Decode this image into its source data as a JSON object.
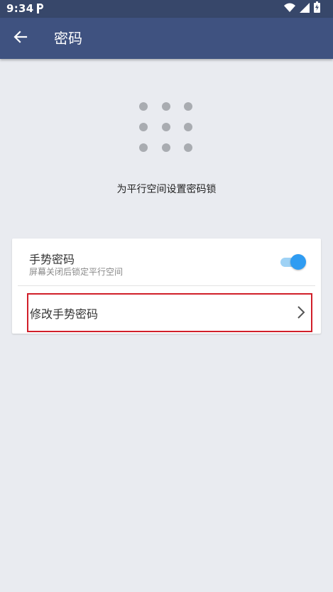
{
  "status_bar": {
    "time": "9:34",
    "icons": [
      "parking-icon",
      "wifi-icon",
      "signal-icon",
      "battery-charging-icon"
    ]
  },
  "app_bar": {
    "back_icon": "arrow-left-icon",
    "title": "密码"
  },
  "pattern": {
    "icon": "pattern-dots-icon",
    "caption": "为平行空间设置密码锁"
  },
  "settings": {
    "gesture_password": {
      "title": "手势密码",
      "subtitle": "屏幕关闭后锁定平行空间",
      "enabled": true
    },
    "modify_gesture_password": {
      "label": "修改手势密码",
      "icon": "chevron-right-icon"
    }
  },
  "colors": {
    "status_bar": "#37476a",
    "app_bar": "#3f5280",
    "background": "#e9ebf0",
    "toggle_on": "#2f9cf2",
    "highlight_border": "#d11f2a"
  }
}
